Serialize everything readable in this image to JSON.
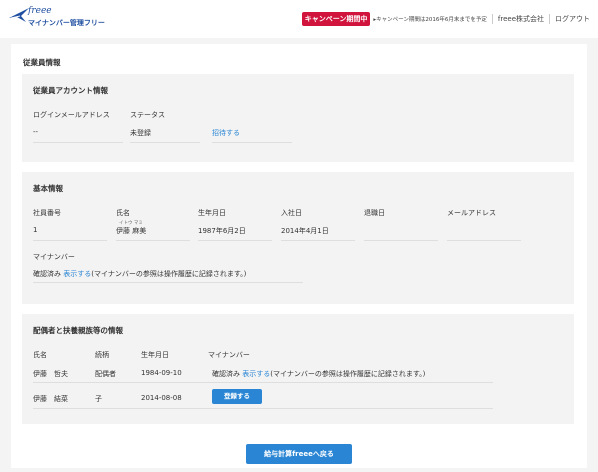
{
  "header": {
    "brand": "freee",
    "app_name": "マイナンバー管理フリー",
    "campaign_badge": "キャンペーン期間中",
    "campaign_note": "▸キャンペーン期間は2016年6月末までを予定",
    "company": "freee株式会社",
    "logout": "ログアウト",
    "colors": {
      "brand": "#1f4fa0",
      "campaign": "#d0143b",
      "accent": "#2a86d4"
    }
  },
  "page_title": "従業員情報",
  "account": {
    "title": "従業員アカウント情報",
    "email_label": "ログインメールアドレス",
    "email_value": "--",
    "status_label": "ステータス",
    "status_value": "未登録",
    "invite_link": "招待する"
  },
  "basic": {
    "title": "基本情報",
    "labels": {
      "employee_no": "社員番号",
      "name": "氏名",
      "birthday": "生年月日",
      "hire_date": "入社日",
      "leave_date": "退職日",
      "email": "メールアドレス"
    },
    "values": {
      "employee_no": "1",
      "name_kana": "イトウ マミ",
      "name": "伊藤 麻美",
      "birthday": "1987年6月2日",
      "hire_date": "2014年4月1日"
    },
    "mynumber_label": "マイナンバー",
    "mynumber_status": "確認済み",
    "mynumber_link": "表示する",
    "mynumber_note": "(マイナンバーの参照は操作履歴に記録されます。)"
  },
  "family": {
    "title": "配偶者と扶養親族等の情報",
    "headers": [
      "氏名",
      "続柄",
      "生年月日",
      "マイナンバー"
    ],
    "rows": [
      {
        "name": "伊藤　哲夫",
        "relation": "配偶者",
        "birthday": "1984-09-10",
        "mynumber_status": "確認済み",
        "mynumber_link": "表示する",
        "mynumber_note": "(マイナンバーの参照は操作履歴に記録されます。)"
      },
      {
        "name": "伊藤　結菜",
        "relation": "子",
        "birthday": "2014-08-08",
        "register_button": "登録する"
      }
    ]
  },
  "footer": {
    "back_button": "給与計算freeeへ戻る"
  }
}
